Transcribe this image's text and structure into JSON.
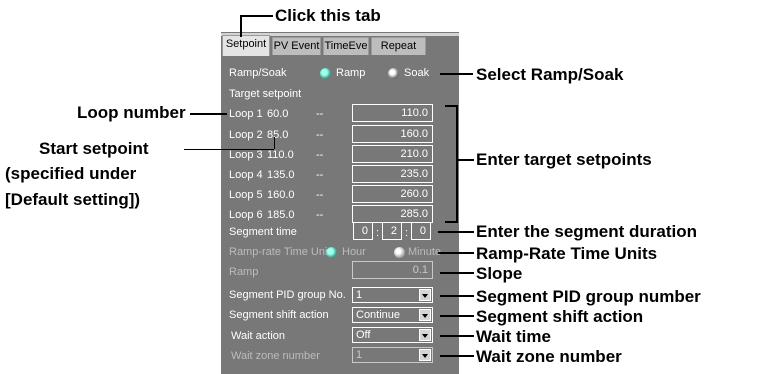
{
  "tabs": [
    {
      "label": "Setpoint",
      "active": true
    },
    {
      "label": "PV Event",
      "active": false
    },
    {
      "label": "TimeEve",
      "active": false
    },
    {
      "label": "Repeat",
      "active": false
    }
  ],
  "form": {
    "ramp_soak_label": "Ramp/Soak",
    "ramp_option": "Ramp",
    "soak_option": "Soak",
    "target_setpoint_label": "Target setpoint",
    "dash": "--",
    "loops": [
      {
        "name": "Loop 1",
        "start": "60.0",
        "target": "110.0"
      },
      {
        "name": "Loop 2",
        "start": "85.0",
        "target": "160.0"
      },
      {
        "name": "Loop 3",
        "start": "110.0",
        "target": "210.0"
      },
      {
        "name": "Loop 4",
        "start": "135.0",
        "target": "235.0"
      },
      {
        "name": "Loop 5",
        "start": "160.0",
        "target": "260.0"
      },
      {
        "name": "Loop 6",
        "start": "185.0",
        "target": "285.0"
      }
    ],
    "segment_time_label": "Segment time",
    "segment_time_h": "0",
    "segment_time_m": "2",
    "segment_time_s": "0",
    "colon": ":",
    "ramp_rate_unit_label": "Ramp-rate Time Unit",
    "hour_option": "Hour",
    "minute_option": "Minute",
    "ramp_label": "Ramp",
    "ramp_value": "0.1",
    "pid_group_label": "Segment PID group No.",
    "pid_group_value": "1",
    "shift_action_label": "Segment shift action",
    "shift_action_value": "Continue",
    "wait_action_label": "Wait action",
    "wait_action_value": "Off",
    "wait_zone_label": "Wait zone number",
    "wait_zone_value": "1"
  },
  "callouts": {
    "click_tab": "Click this tab",
    "select_ramp_soak": "Select Ramp/Soak",
    "loop_number": "Loop number",
    "start_setpoint_1": "Start setpoint",
    "start_setpoint_2": "(specified under",
    "start_setpoint_3": "[Default setting])",
    "enter_targets": "Enter target setpoints",
    "segment_duration": "Enter the segment duration",
    "ramp_rate_units": "Ramp-Rate Time Units",
    "slope": "Slope",
    "pid_group": "Segment PID group number",
    "shift_action": "Segment shift action",
    "wait_time": "Wait time",
    "wait_zone": "Wait zone number"
  }
}
